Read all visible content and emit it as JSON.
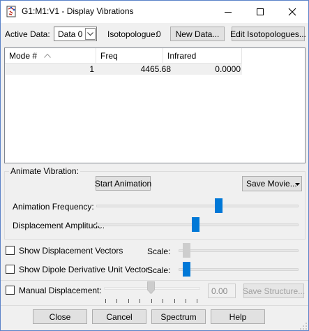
{
  "window": {
    "title": "G1:M1:V1 - Display Vibrations"
  },
  "icons": {
    "app": "gaussview-icon",
    "minimize": "minimize-icon",
    "maximize": "maximize-icon",
    "close": "close-icon",
    "sort": "sort-ascending-icon",
    "dropdown": "chevron-down-icon",
    "menu_arrow": "dropdown-arrow-icon"
  },
  "colors": {
    "accent": "#0078d7",
    "window_border": "#5a82c8"
  },
  "toolbar": {
    "active_data_label": "Active Data:",
    "active_data_value": "Data 0",
    "isotopologue_label": "Isotopologue:",
    "isotopologue_value": "0",
    "new_data_button": "New Data...",
    "edit_isotopologues_button": "Edit Isotopologues..."
  },
  "table": {
    "columns": [
      "Mode #",
      "Freq",
      "Infrared"
    ],
    "rows": [
      {
        "mode": "1",
        "freq": "4465.68",
        "infrared": "0.0000"
      }
    ]
  },
  "animate": {
    "group_label": "Animate Vibration:",
    "start_button": "Start Animation",
    "save_movie_button": "Save Movie...",
    "frequency_label": "Animation Frequency:",
    "frequency_level": 0.61,
    "amplitude_label": "Displacement Amplitude:",
    "amplitude_level": 0.49
  },
  "options": {
    "show_displacement_vectors": {
      "label": "Show Displacement Vectors",
      "checked": false,
      "scale_label": "Scale:",
      "scale_level": 0.02
    },
    "show_dipole_vector": {
      "label": "Show Dipole Derivative Unit Vector",
      "checked": false,
      "scale_label": "Scale:",
      "scale_level": 0.02
    },
    "manual_displacement": {
      "label": "Manual Displacement:",
      "checked": false,
      "value": "0.00",
      "save_structure_button": "Save Structure..."
    }
  },
  "footer": {
    "close_button": "Close",
    "cancel_button": "Cancel",
    "spectrum_button": "Spectrum",
    "help_button": "Help"
  }
}
